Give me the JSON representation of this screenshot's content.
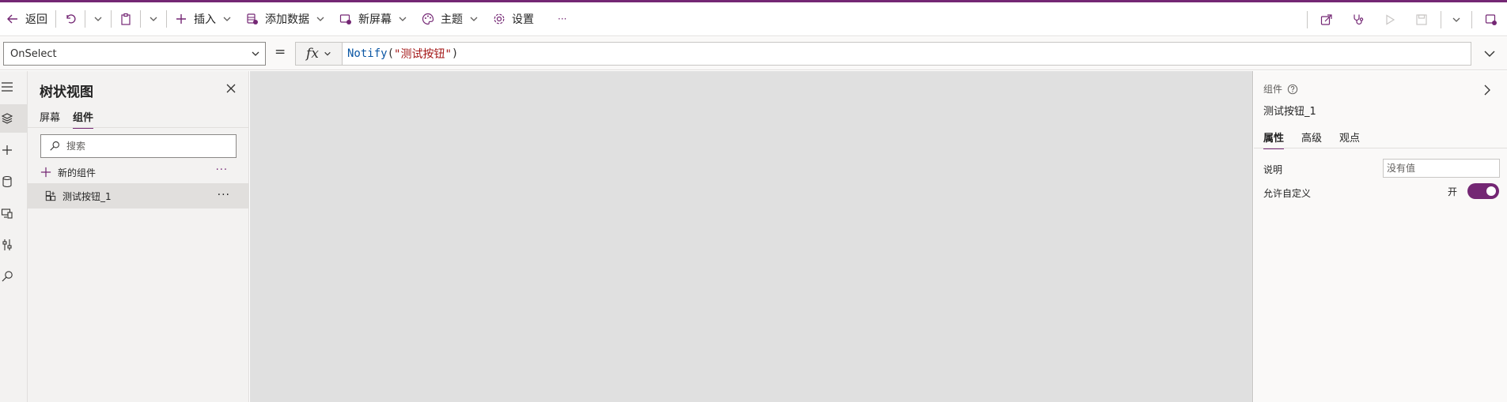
{
  "toolbar": {
    "back_label": "返回",
    "insert_label": "插入",
    "add_data_label": "添加数据",
    "new_screen_label": "新屏幕",
    "theme_label": "主题",
    "settings_label": "设置",
    "more_label": "···"
  },
  "formula_bar": {
    "property_value": "OnSelect",
    "equals": "=",
    "fx_label": "fx",
    "formula_fn": "Notify",
    "formula_open": "(",
    "formula_string": "\"测试按钮\"",
    "formula_close": ")"
  },
  "tree_view": {
    "title": "树状视图",
    "tabs": [
      {
        "label": "屏幕",
        "active": false
      },
      {
        "label": "组件",
        "active": true
      }
    ],
    "search_placeholder": "搜索",
    "new_component_label": "新的组件",
    "more_label": "···",
    "items": [
      {
        "label": "测试按钮_1",
        "more_label": "···"
      }
    ]
  },
  "properties_panel": {
    "category": "组件",
    "component_name": "测试按钮_1",
    "tabs": [
      {
        "label": "属性",
        "active": true
      },
      {
        "label": "高级",
        "active": false
      },
      {
        "label": "观点",
        "active": false
      }
    ],
    "description_label": "说明",
    "description_placeholder": "没有值",
    "allow_customization_label": "允许自定义",
    "toggle_state_label": "开",
    "toggle_on": true
  },
  "colors": {
    "accent": "#742774",
    "canvas": "#e0e0e0",
    "panel": "#f3f2f1"
  }
}
